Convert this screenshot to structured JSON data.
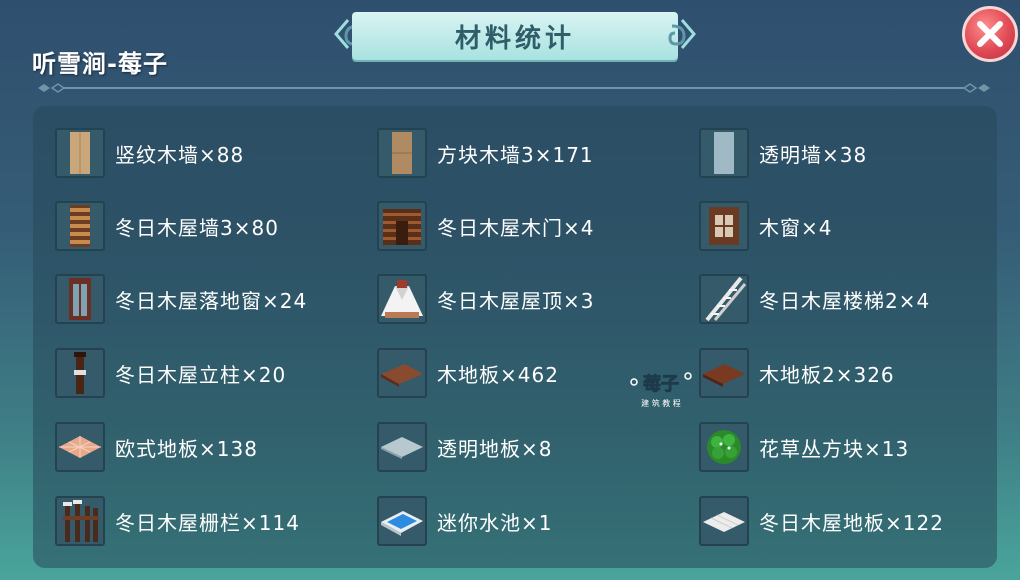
{
  "header": {
    "user_name": "听雪涧-莓子",
    "title": "材料统计"
  },
  "materials": [
    {
      "label": "竖纹木墙×88",
      "icon": "vertical-wood-wall-icon"
    },
    {
      "label": "方块木墙3×171",
      "icon": "block-wood-wall-icon"
    },
    {
      "label": "透明墙×38",
      "icon": "transparent-wall-icon"
    },
    {
      "label": "冬日木屋墙3×80",
      "icon": "winter-cabin-wall-icon"
    },
    {
      "label": "冬日木屋木门×4",
      "icon": "winter-cabin-door-icon"
    },
    {
      "label": "木窗×4",
      "icon": "wood-window-icon"
    },
    {
      "label": "冬日木屋落地窗×24",
      "icon": "winter-cabin-french-window-icon"
    },
    {
      "label": "冬日木屋屋顶×3",
      "icon": "winter-cabin-roof-icon"
    },
    {
      "label": "冬日木屋楼梯2×4",
      "icon": "winter-cabin-stairs-icon"
    },
    {
      "label": "冬日木屋立柱×20",
      "icon": "winter-cabin-pillar-icon"
    },
    {
      "label": "木地板×462",
      "icon": "wood-floor-icon"
    },
    {
      "label": "木地板2×326",
      "icon": "wood-floor-2-icon"
    },
    {
      "label": "欧式地板×138",
      "icon": "european-floor-icon"
    },
    {
      "label": "透明地板×8",
      "icon": "transparent-floor-icon"
    },
    {
      "label": "花草丛方块×13",
      "icon": "flower-bush-block-icon"
    },
    {
      "label": "冬日木屋栅栏×114",
      "icon": "winter-cabin-fence-icon"
    },
    {
      "label": "迷你水池×1",
      "icon": "mini-pool-icon"
    },
    {
      "label": "冬日木屋地板×122",
      "icon": "winter-cabin-floor-icon"
    }
  ],
  "watermark": {
    "text": "莓子",
    "subtext": "建 筑 教 程"
  },
  "colors": {
    "title_banner": "#bfeceb",
    "title_text": "#2f5e69",
    "close_button": "#e04a55",
    "panel": "#2b5566"
  }
}
